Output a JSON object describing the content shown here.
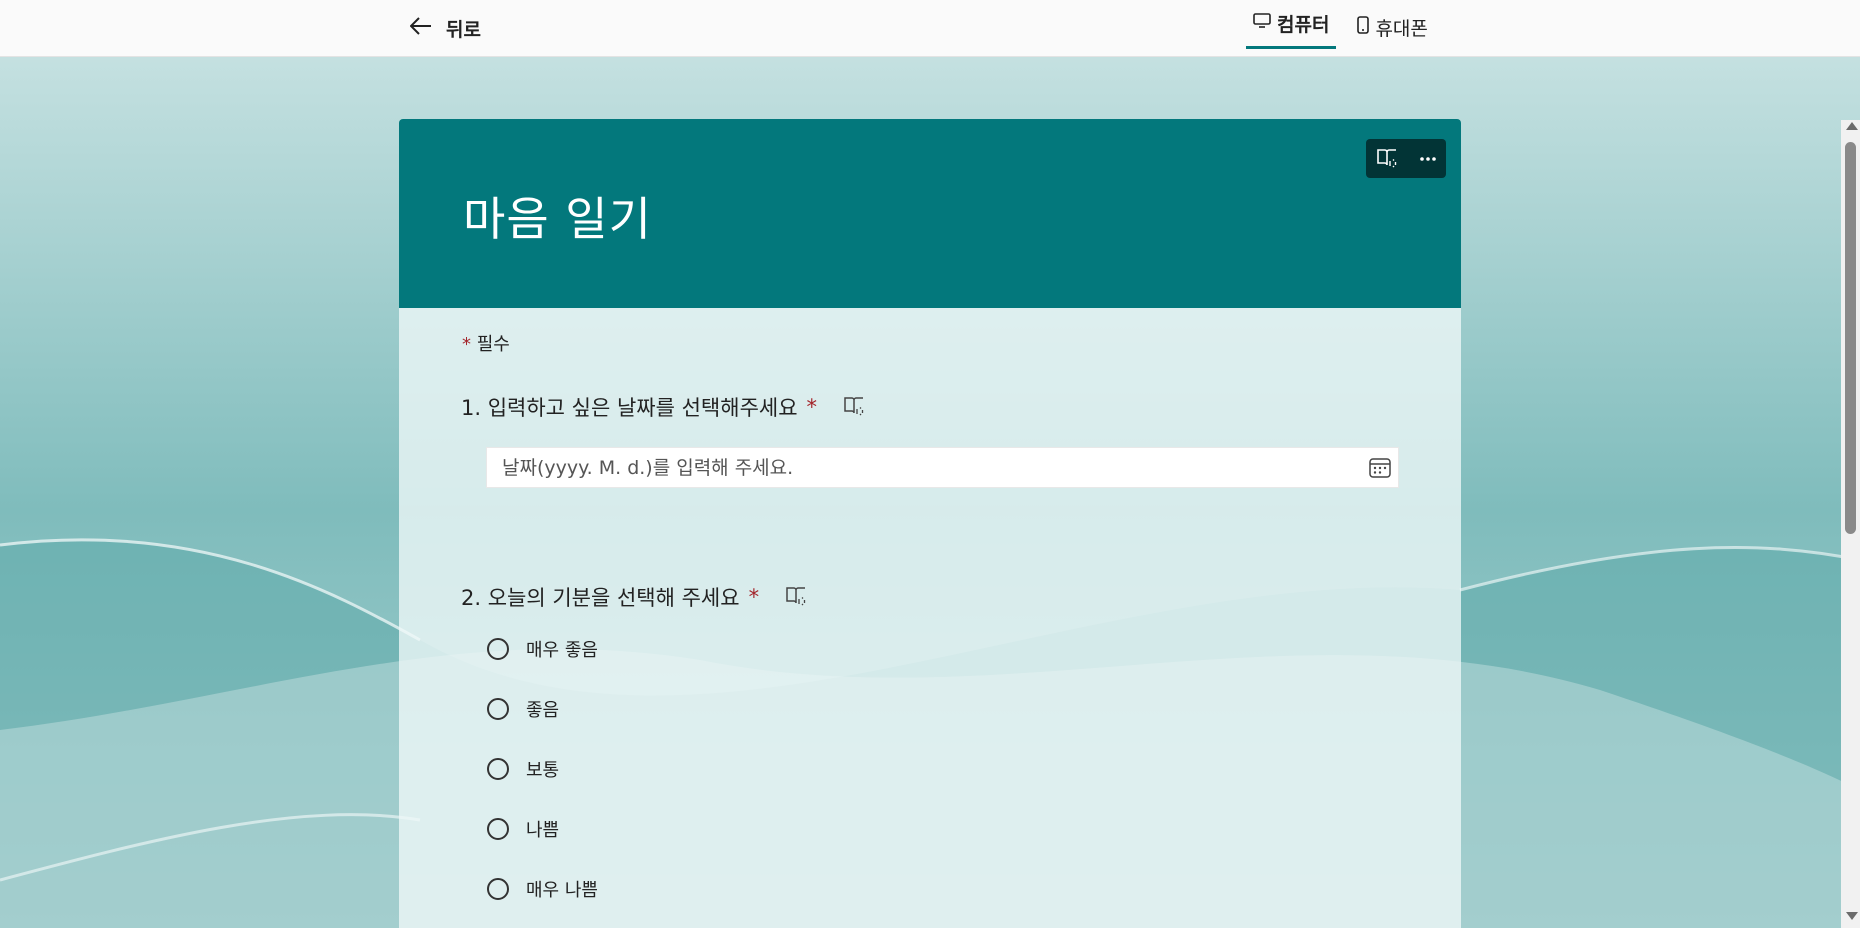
{
  "topbar": {
    "back_label": "뒤로",
    "tabs": [
      {
        "label": "컴퓨터",
        "active": true,
        "icon": "monitor-icon"
      },
      {
        "label": "휴대폰",
        "active": false,
        "icon": "phone-icon"
      }
    ]
  },
  "form": {
    "title": "마음 일기",
    "required_note": "필수",
    "required_mark": "*",
    "theme_color": "#03787c",
    "questions": [
      {
        "label": "1. 입력하고 싶은 날짜를 선택해주세요",
        "date_placeholder": "날짜(yyyy. M. d.)를 입력해 주세요."
      },
      {
        "label": "2. 오늘의 기분을 선택해 주세요",
        "options": [
          "매우 좋음",
          "좋음",
          "보통",
          "나쁨",
          "매우 나쁨"
        ]
      }
    ]
  },
  "icons": {
    "back": "arrow-left-icon",
    "reader": "immersive-reader-icon",
    "more": "more-dots-icon",
    "calendar": "calendar-icon"
  }
}
